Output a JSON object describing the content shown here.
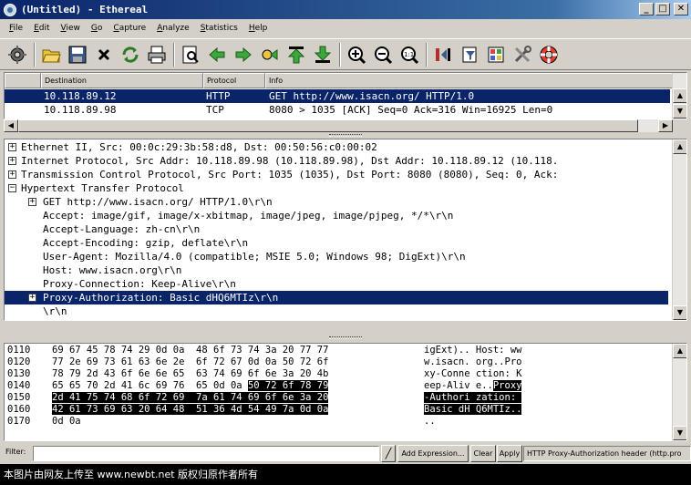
{
  "window": {
    "title": "(Untitled) - Ethereal",
    "minimize_glyph": "_",
    "maximize_glyph": "□",
    "close_glyph": "✕"
  },
  "menu": [
    {
      "label": "File",
      "u": "F",
      "rest": "ile"
    },
    {
      "label": "Edit",
      "u": "E",
      "rest": "dit"
    },
    {
      "label": "View",
      "u": "V",
      "rest": "iew"
    },
    {
      "label": "Go",
      "u": "G",
      "rest": "o"
    },
    {
      "label": "Capture",
      "u": "C",
      "rest": "apture"
    },
    {
      "label": "Analyze",
      "u": "A",
      "rest": "nalyze"
    },
    {
      "label": "Statistics",
      "u": "S",
      "rest": "tatistics"
    },
    {
      "label": "Help",
      "u": "H",
      "rest": "elp"
    }
  ],
  "packet_list": {
    "columns": [
      "Destination",
      "Protocol",
      "Info"
    ],
    "rows": [
      {
        "destination": "10.118.89.12",
        "protocol": "HTTP",
        "info": "GET http://www.isacn.org/ HTTP/1.0",
        "selected": true
      },
      {
        "destination": "10.118.89.98",
        "protocol": "TCP",
        "info": "8080 > 1035 [ACK] Seq=0 Ack=316 Win=16925 Len=0",
        "selected": false
      }
    ]
  },
  "details": [
    {
      "text": "Ethernet II, Src: 00:0c:29:3b:58:d8, Dst: 00:50:56:c0:00:02",
      "level": 0,
      "expander": "+"
    },
    {
      "text": "Internet Protocol, Src Addr: 10.118.89.98 (10.118.89.98), Dst Addr: 10.118.89.12 (10.118.",
      "level": 0,
      "expander": "+"
    },
    {
      "text": "Transmission Control Protocol, Src Port: 1035 (1035), Dst Port: 8080 (8080), Seq: 0, Ack:",
      "level": 0,
      "expander": "+"
    },
    {
      "text": "Hypertext Transfer Protocol",
      "level": 0,
      "expander": "-"
    },
    {
      "text": "GET http://www.isacn.org/ HTTP/1.0\\r\\n",
      "level": 1,
      "expander": "+"
    },
    {
      "text": "Accept: image/gif, image/x-xbitmap, image/jpeg, image/pjpeg, */*\\r\\n",
      "level": 1,
      "expander": ""
    },
    {
      "text": "Accept-Language: zh-cn\\r\\n",
      "level": 1,
      "expander": ""
    },
    {
      "text": "Accept-Encoding: gzip, deflate\\r\\n",
      "level": 1,
      "expander": ""
    },
    {
      "text": "User-Agent: Mozilla/4.0 (compatible; MSIE 5.0; Windows 98; DigExt)\\r\\n",
      "level": 1,
      "expander": ""
    },
    {
      "text": "Host: www.isacn.org\\r\\n",
      "level": 1,
      "expander": ""
    },
    {
      "text": "Proxy-Connection: Keep-Alive\\r\\n",
      "level": 1,
      "expander": ""
    },
    {
      "text": "Proxy-Authorization: Basic dHQ6MTIz\\r\\n",
      "level": 1,
      "expander": "+",
      "selected": true
    },
    {
      "text": "\\r\\n",
      "level": 1,
      "expander": ""
    }
  ],
  "hex_dump": [
    {
      "offset": "0110",
      "bytes_plain": "69 67 45 78 74 29 0d 0a  48 6f 73 74 3a 20 77 77",
      "bytes_hl": "",
      "ascii_plain": "igExt).. Host: ww",
      "ascii_hl": ""
    },
    {
      "offset": "0120",
      "bytes_plain": "77 2e 69 73 61 63 6e 2e  6f 72 67 0d 0a 50 72 6f",
      "bytes_hl": "",
      "ascii_plain": "w.isacn. org..Pro",
      "ascii_hl": ""
    },
    {
      "offset": "0130",
      "bytes_plain": "78 79 2d 43 6f 6e 6e 65  63 74 69 6f 6e 3a 20 4b",
      "bytes_hl": "",
      "ascii_plain": "xy-Conne ction: K",
      "ascii_hl": ""
    },
    {
      "offset": "0140",
      "bytes_plain": "65 65 70 2d 41 6c 69 76  65 0d 0a ",
      "bytes_hl": "50 72 6f 78 79",
      "ascii_plain": "eep-Aliv e..",
      "ascii_hl": "Proxy"
    },
    {
      "offset": "0150",
      "bytes_plain": "",
      "bytes_hl": "2d 41 75 74 68 6f 72 69  7a 61 74 69 6f 6e 3a 20",
      "ascii_plain": "",
      "ascii_hl": "-Authori zation: "
    },
    {
      "offset": "0160",
      "bytes_plain": "",
      "bytes_hl": "42 61 73 69 63 20 64 48  51 36 4d 54 49 7a 0d 0a",
      "ascii_plain": "",
      "ascii_hl": "Basic dH Q6MTIz.."
    },
    {
      "offset": "0170",
      "bytes_plain": "0d 0a",
      "bytes_hl": "",
      "ascii_plain": "..",
      "ascii_hl": ""
    }
  ],
  "filter": {
    "label": "Filter:",
    "value": "",
    "expression_button": "Add Expression...",
    "clear_button": "Clear",
    "apply_button": "Apply"
  },
  "status": "HTTP Proxy-Authorization header (http.pro",
  "caption": "本图片由网友上传至 www.newbt.net 版权归原作者所有",
  "colors": {
    "selection": "#0a246a",
    "chrome": "#d4d0c8"
  }
}
